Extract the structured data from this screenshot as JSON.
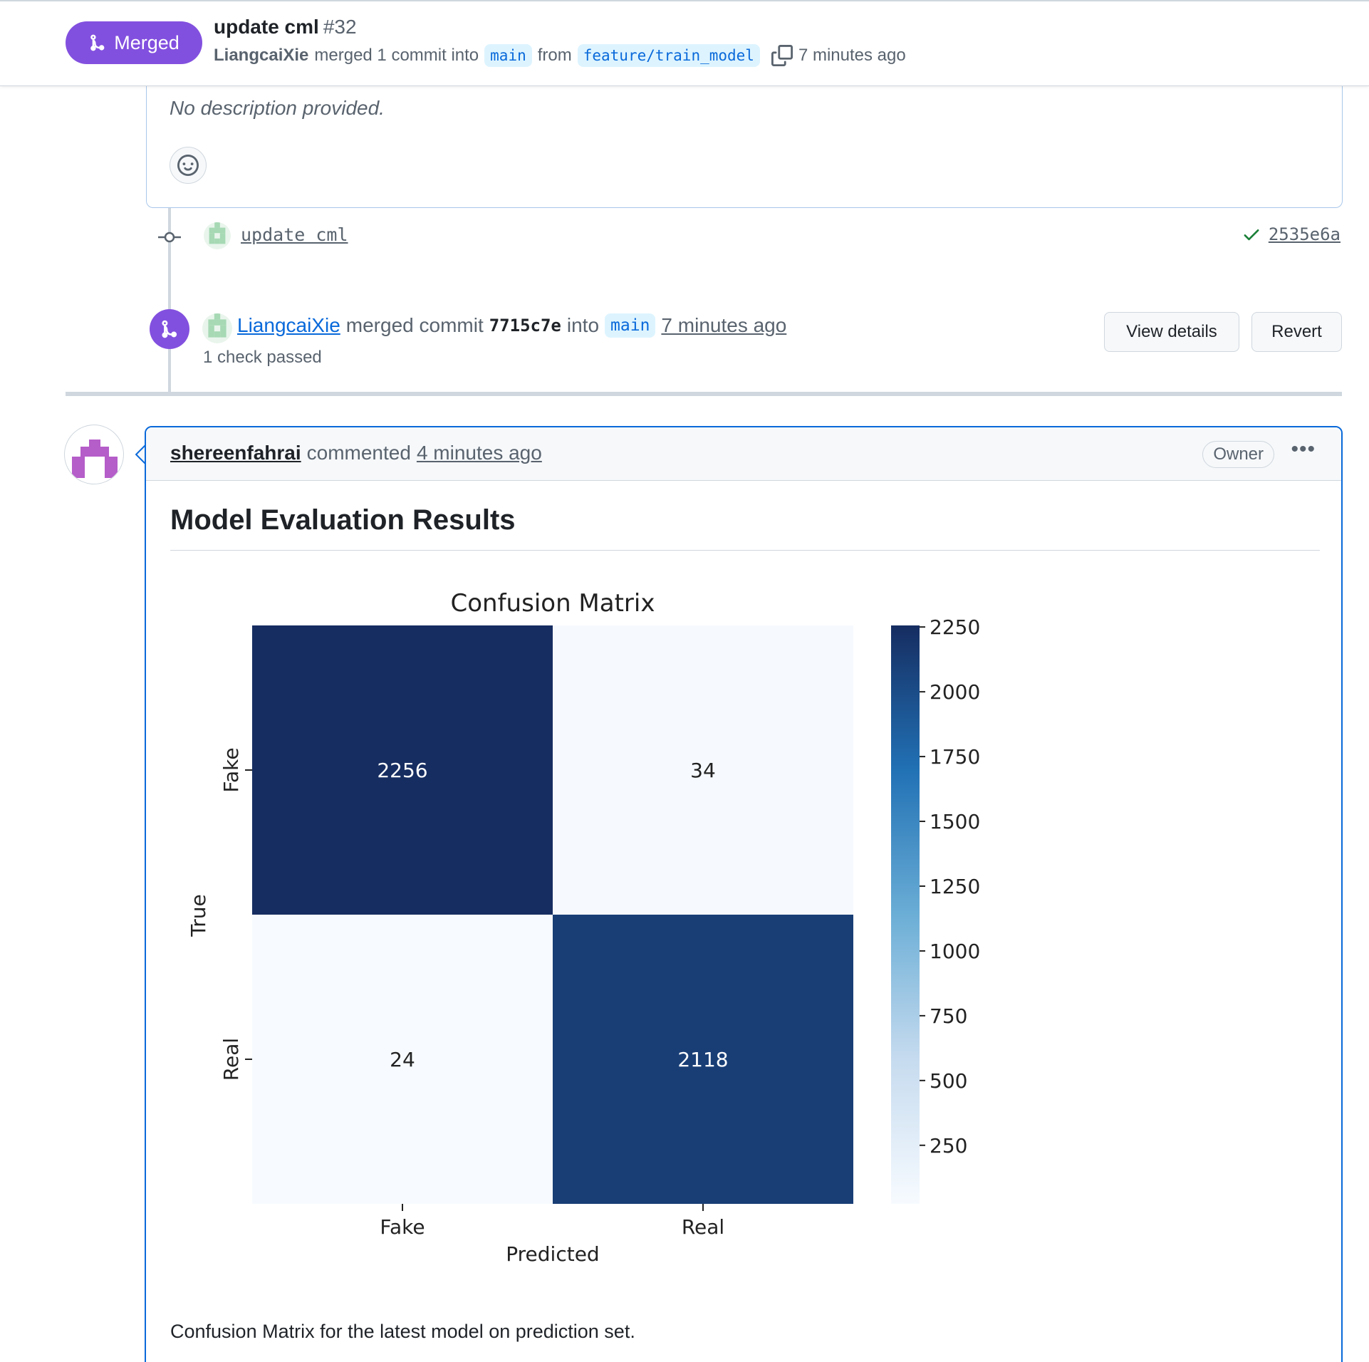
{
  "header": {
    "state_label": "Merged",
    "title": "update cml",
    "number": "#32",
    "author": "LiangcaiXie",
    "merged_text": "merged 1 commit into",
    "base_branch": "main",
    "from_text": "from",
    "head_branch": "feature/train_model",
    "time": "7 minutes ago"
  },
  "description": {
    "text": "No description provided."
  },
  "commit": {
    "message": "update cml",
    "sha": "2535e6a"
  },
  "merge_event": {
    "user": "LiangcaiXie",
    "action": "merged commit",
    "sha": "7715c7e",
    "into_text": "into",
    "branch": "main",
    "time": "7 minutes ago",
    "checks": "1 check passed",
    "view_details_label": "View details",
    "revert_label": "Revert"
  },
  "comment": {
    "user": "shereenfahrai",
    "action": "commented",
    "time": "4 minutes ago",
    "role_badge": "Owner",
    "heading": "Model Evaluation Results",
    "caption": "Confusion Matrix for the latest model on prediction set."
  },
  "colors": {
    "merged_purple": "#8250df",
    "link_blue": "#0969da",
    "success_green": "#1a7f37"
  },
  "chart_data": {
    "type": "heatmap",
    "title": "Confusion Matrix",
    "xlabel": "Predicted",
    "ylabel": "True",
    "x_categories": [
      "Fake",
      "Real"
    ],
    "y_categories": [
      "Fake",
      "Real"
    ],
    "values": [
      [
        2256,
        34
      ],
      [
        24,
        2118
      ]
    ],
    "colormap": "Blues",
    "colorbar": {
      "min": 24,
      "max": 2256,
      "ticks": [
        250,
        500,
        750,
        1000,
        1250,
        1500,
        1750,
        2000,
        2250
      ]
    }
  }
}
